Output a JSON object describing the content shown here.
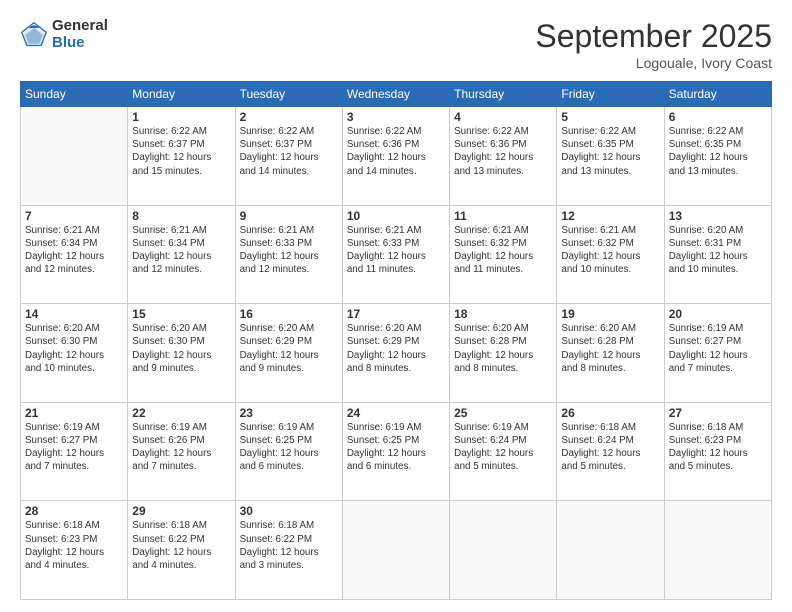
{
  "logo": {
    "general": "General",
    "blue": "Blue"
  },
  "header": {
    "month": "September 2025",
    "location": "Logouale, Ivory Coast"
  },
  "days_of_week": [
    "Sunday",
    "Monday",
    "Tuesday",
    "Wednesday",
    "Thursday",
    "Friday",
    "Saturday"
  ],
  "weeks": [
    [
      {
        "day": "",
        "info": ""
      },
      {
        "day": "1",
        "info": "Sunrise: 6:22 AM\nSunset: 6:37 PM\nDaylight: 12 hours\nand 15 minutes."
      },
      {
        "day": "2",
        "info": "Sunrise: 6:22 AM\nSunset: 6:37 PM\nDaylight: 12 hours\nand 14 minutes."
      },
      {
        "day": "3",
        "info": "Sunrise: 6:22 AM\nSunset: 6:36 PM\nDaylight: 12 hours\nand 14 minutes."
      },
      {
        "day": "4",
        "info": "Sunrise: 6:22 AM\nSunset: 6:36 PM\nDaylight: 12 hours\nand 13 minutes."
      },
      {
        "day": "5",
        "info": "Sunrise: 6:22 AM\nSunset: 6:35 PM\nDaylight: 12 hours\nand 13 minutes."
      },
      {
        "day": "6",
        "info": "Sunrise: 6:22 AM\nSunset: 6:35 PM\nDaylight: 12 hours\nand 13 minutes."
      }
    ],
    [
      {
        "day": "7",
        "info": "Sunrise: 6:21 AM\nSunset: 6:34 PM\nDaylight: 12 hours\nand 12 minutes."
      },
      {
        "day": "8",
        "info": "Sunrise: 6:21 AM\nSunset: 6:34 PM\nDaylight: 12 hours\nand 12 minutes."
      },
      {
        "day": "9",
        "info": "Sunrise: 6:21 AM\nSunset: 6:33 PM\nDaylight: 12 hours\nand 12 minutes."
      },
      {
        "day": "10",
        "info": "Sunrise: 6:21 AM\nSunset: 6:33 PM\nDaylight: 12 hours\nand 11 minutes."
      },
      {
        "day": "11",
        "info": "Sunrise: 6:21 AM\nSunset: 6:32 PM\nDaylight: 12 hours\nand 11 minutes."
      },
      {
        "day": "12",
        "info": "Sunrise: 6:21 AM\nSunset: 6:32 PM\nDaylight: 12 hours\nand 10 minutes."
      },
      {
        "day": "13",
        "info": "Sunrise: 6:20 AM\nSunset: 6:31 PM\nDaylight: 12 hours\nand 10 minutes."
      }
    ],
    [
      {
        "day": "14",
        "info": "Sunrise: 6:20 AM\nSunset: 6:30 PM\nDaylight: 12 hours\nand 10 minutes."
      },
      {
        "day": "15",
        "info": "Sunrise: 6:20 AM\nSunset: 6:30 PM\nDaylight: 12 hours\nand 9 minutes."
      },
      {
        "day": "16",
        "info": "Sunrise: 6:20 AM\nSunset: 6:29 PM\nDaylight: 12 hours\nand 9 minutes."
      },
      {
        "day": "17",
        "info": "Sunrise: 6:20 AM\nSunset: 6:29 PM\nDaylight: 12 hours\nand 8 minutes."
      },
      {
        "day": "18",
        "info": "Sunrise: 6:20 AM\nSunset: 6:28 PM\nDaylight: 12 hours\nand 8 minutes."
      },
      {
        "day": "19",
        "info": "Sunrise: 6:20 AM\nSunset: 6:28 PM\nDaylight: 12 hours\nand 8 minutes."
      },
      {
        "day": "20",
        "info": "Sunrise: 6:19 AM\nSunset: 6:27 PM\nDaylight: 12 hours\nand 7 minutes."
      }
    ],
    [
      {
        "day": "21",
        "info": "Sunrise: 6:19 AM\nSunset: 6:27 PM\nDaylight: 12 hours\nand 7 minutes."
      },
      {
        "day": "22",
        "info": "Sunrise: 6:19 AM\nSunset: 6:26 PM\nDaylight: 12 hours\nand 7 minutes."
      },
      {
        "day": "23",
        "info": "Sunrise: 6:19 AM\nSunset: 6:25 PM\nDaylight: 12 hours\nand 6 minutes."
      },
      {
        "day": "24",
        "info": "Sunrise: 6:19 AM\nSunset: 6:25 PM\nDaylight: 12 hours\nand 6 minutes."
      },
      {
        "day": "25",
        "info": "Sunrise: 6:19 AM\nSunset: 6:24 PM\nDaylight: 12 hours\nand 5 minutes."
      },
      {
        "day": "26",
        "info": "Sunrise: 6:18 AM\nSunset: 6:24 PM\nDaylight: 12 hours\nand 5 minutes."
      },
      {
        "day": "27",
        "info": "Sunrise: 6:18 AM\nSunset: 6:23 PM\nDaylight: 12 hours\nand 5 minutes."
      }
    ],
    [
      {
        "day": "28",
        "info": "Sunrise: 6:18 AM\nSunset: 6:23 PM\nDaylight: 12 hours\nand 4 minutes."
      },
      {
        "day": "29",
        "info": "Sunrise: 6:18 AM\nSunset: 6:22 PM\nDaylight: 12 hours\nand 4 minutes."
      },
      {
        "day": "30",
        "info": "Sunrise: 6:18 AM\nSunset: 6:22 PM\nDaylight: 12 hours\nand 3 minutes."
      },
      {
        "day": "",
        "info": ""
      },
      {
        "day": "",
        "info": ""
      },
      {
        "day": "",
        "info": ""
      },
      {
        "day": "",
        "info": ""
      }
    ]
  ]
}
